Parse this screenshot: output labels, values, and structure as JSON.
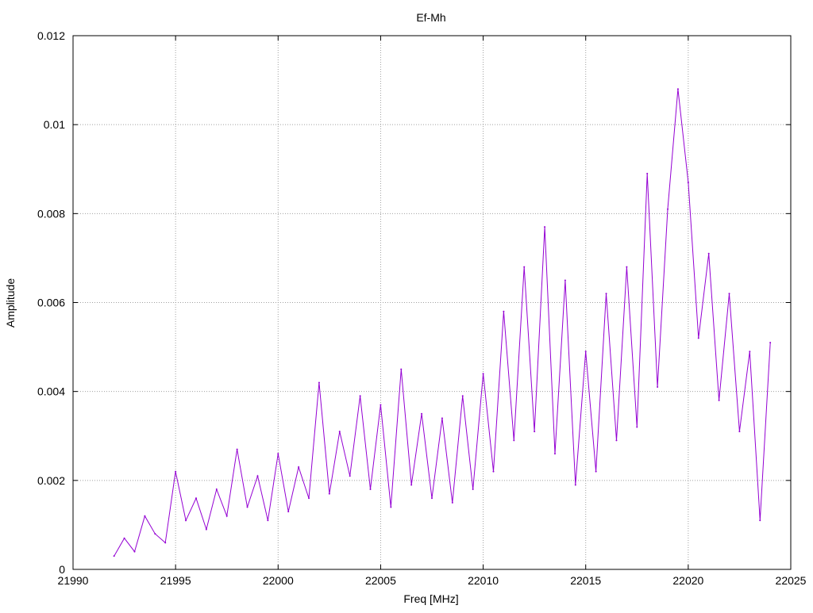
{
  "chart_data": {
    "type": "line",
    "title": "Ef-Mh",
    "xlabel": "Freq [MHz]",
    "ylabel": "Amplitude",
    "xlim": [
      21990,
      22025
    ],
    "ylim": [
      0,
      0.012
    ],
    "xticks": [
      21990,
      21995,
      22000,
      22005,
      22010,
      22015,
      22020,
      22025
    ],
    "yticks": [
      0,
      0.002,
      0.004,
      0.006,
      0.008,
      0.01,
      0.012
    ],
    "xtick_labels": [
      "21990",
      "21995",
      "22000",
      "22005",
      "22010",
      "22015",
      "22020",
      "22025"
    ],
    "ytick_labels": [
      "0",
      "0.002",
      "0.004",
      "0.006",
      "0.008",
      "0.01",
      "0.012"
    ],
    "grid": true,
    "series": [
      {
        "color": "#9400d3",
        "x": [
          21992.0,
          21992.5,
          21993.0,
          21993.5,
          21994.0,
          21994.5,
          21995.0,
          21995.5,
          21996.0,
          21996.5,
          21997.0,
          21997.5,
          21998.0,
          21998.5,
          21999.0,
          21999.5,
          22000.0,
          22000.5,
          22001.0,
          22001.5,
          22002.0,
          22002.5,
          22003.0,
          22003.5,
          22004.0,
          22004.5,
          22005.0,
          22005.5,
          22006.0,
          22006.5,
          22007.0,
          22007.5,
          22008.0,
          22008.5,
          22009.0,
          22009.5,
          22010.0,
          22010.5,
          22011.0,
          22011.5,
          22012.0,
          22012.5,
          22013.0,
          22013.5,
          22014.0,
          22014.5,
          22015.0,
          22015.5,
          22016.0,
          22016.5,
          22017.0,
          22017.5,
          22018.0,
          22018.5,
          22019.0,
          22019.5,
          22020.0,
          22020.5,
          22021.0,
          22021.5,
          22022.0,
          22022.5,
          22023.0,
          22023.5,
          22024.0
        ],
        "y": [
          0.0003,
          0.0007,
          0.0004,
          0.0012,
          0.0008,
          0.0006,
          0.0022,
          0.0011,
          0.0016,
          0.0009,
          0.0018,
          0.0012,
          0.0027,
          0.0014,
          0.0021,
          0.0011,
          0.0026,
          0.0013,
          0.0023,
          0.0016,
          0.0042,
          0.0017,
          0.0031,
          0.0021,
          0.0039,
          0.0018,
          0.0037,
          0.0014,
          0.0045,
          0.0019,
          0.0035,
          0.0016,
          0.0034,
          0.0015,
          0.0039,
          0.0018,
          0.0044,
          0.0022,
          0.0058,
          0.0029,
          0.0068,
          0.0031,
          0.0077,
          0.0026,
          0.0065,
          0.0019,
          0.0049,
          0.0022,
          0.0062,
          0.0029,
          0.0068,
          0.0032,
          0.0089,
          0.0041,
          0.0081,
          0.0108,
          0.0087,
          0.0052,
          0.0071,
          0.0038,
          0.0062,
          0.0031,
          0.0049,
          0.0011,
          0.0051
        ]
      }
    ]
  }
}
